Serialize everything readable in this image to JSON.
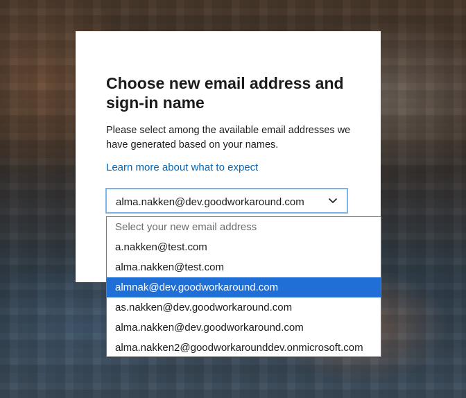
{
  "dialog": {
    "title": "Choose new email address and sign-in name",
    "description": "Please select among the available email addresses we have generated based on your names.",
    "learn_more_link": "Learn more about what to expect"
  },
  "email_select": {
    "current_value": "alma.nakken@dev.goodworkaround.com",
    "placeholder": "Select your new email address",
    "highlighted_option": "almnak@dev.goodworkaround.com",
    "options": [
      "a.nakken@test.com",
      "alma.nakken@test.com",
      "almnak@dev.goodworkaround.com",
      "as.nakken@dev.goodworkaround.com",
      "alma.nakken@dev.goodworkaround.com",
      "alma.nakken2@goodworkarounddev.onmicrosoft.com"
    ]
  },
  "colors": {
    "link": "#0067b8",
    "highlight": "#1f6fd6",
    "select_focus_border": "#7fb3e6"
  },
  "icons": {
    "select_arrow": "chevron-down-icon"
  }
}
